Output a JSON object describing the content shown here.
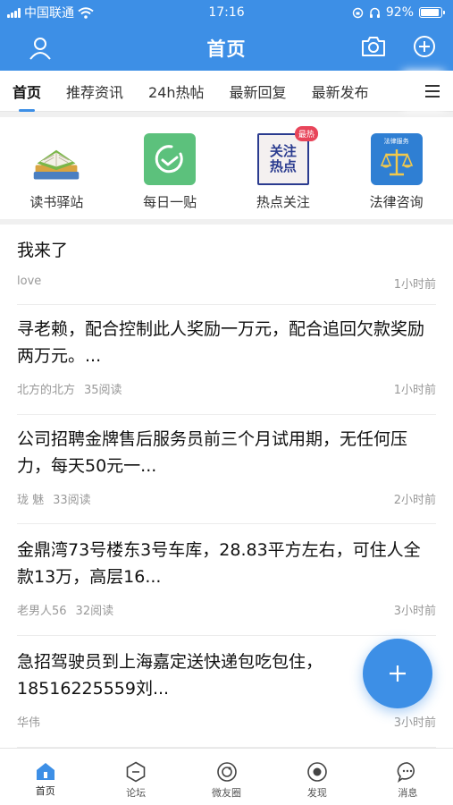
{
  "status": {
    "carrier": "中国联通",
    "time": "17:16",
    "battery": "92%"
  },
  "navbar": {
    "title": "首页",
    "icons": [
      "user-icon",
      "camera-icon",
      "add-icon"
    ]
  },
  "tabs": [
    {
      "label": "首页",
      "active": true
    },
    {
      "label": "推荐资讯"
    },
    {
      "label": "24h热帖"
    },
    {
      "label": "最新回复"
    },
    {
      "label": "最新发布"
    }
  ],
  "quick": [
    {
      "label": "读书驿站",
      "icon": "books-icon"
    },
    {
      "label": "每日一贴",
      "icon": "clock-icon"
    },
    {
      "label": "热点关注",
      "icon": "hot-topic-icon",
      "badge": "最热",
      "icon_text": "关注热点"
    },
    {
      "label": "法律咨询",
      "icon": "law-scale-icon",
      "icon_text": "法律服务"
    }
  ],
  "posts": [
    {
      "title": "我来了",
      "author": "love",
      "reads": "",
      "time": "1小时前"
    },
    {
      "title": "寻老赖，配合控制此人奖励一万元，配合追回欠款奖励两万元。...",
      "author": "北方的北方",
      "reads": "35阅读",
      "time": "1小时前"
    },
    {
      "title": "公司招聘金牌售后服务员前三个月试用期，无任何压力，每天50元一...",
      "author": "珑 魅",
      "reads": "33阅读",
      "time": "2小时前"
    },
    {
      "title": "金鼎湾73号楼东3号车库，28.83平方左右，可住人全款13万，高层16...",
      "author": "老男人56",
      "reads": "32阅读",
      "time": "3小时前"
    },
    {
      "title": "急招驾驶员到上海嘉定送快递包吃包住，18516225559刘...",
      "author": "华伟",
      "reads": "",
      "time": "3小时前"
    }
  ],
  "tabbar": [
    {
      "label": "首页",
      "icon": "home-icon",
      "active": true
    },
    {
      "label": "论坛",
      "icon": "forum-icon"
    },
    {
      "label": "微友圈",
      "icon": "moments-icon"
    },
    {
      "label": "发现",
      "icon": "discover-icon"
    },
    {
      "label": "消息",
      "icon": "message-icon"
    }
  ],
  "colors": {
    "accent": "#3d8fe6"
  }
}
